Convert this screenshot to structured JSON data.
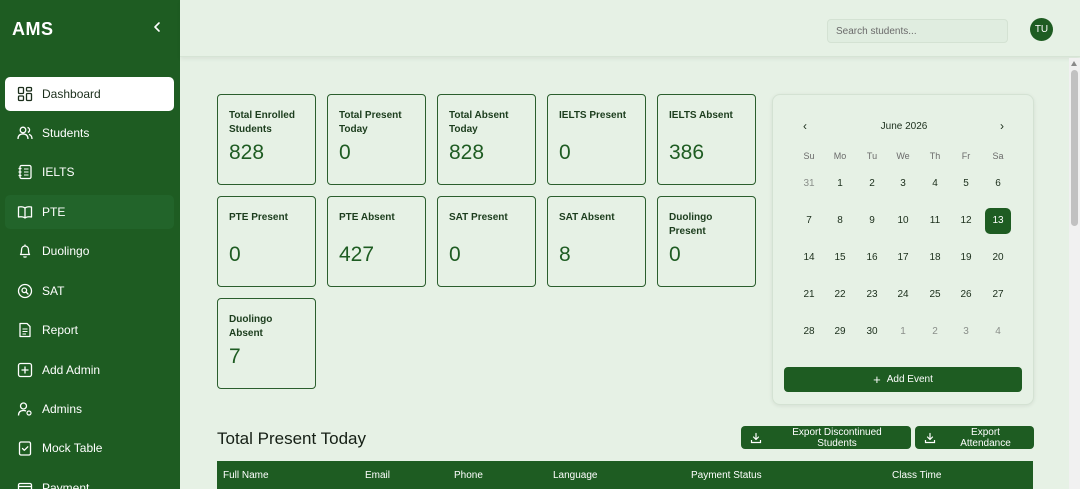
{
  "app": {
    "brand": "AMS"
  },
  "sidebar": {
    "items": [
      {
        "label": "Dashboard",
        "icon": "dashboard-icon"
      },
      {
        "label": "Students",
        "icon": "users-icon"
      },
      {
        "label": "IELTS",
        "icon": "notebook-icon"
      },
      {
        "label": "PTE",
        "icon": "book-open-icon"
      },
      {
        "label": "Duolingo",
        "icon": "bell-icon"
      },
      {
        "label": "SAT",
        "icon": "search-circle-icon"
      },
      {
        "label": "Report",
        "icon": "file-text-icon"
      },
      {
        "label": "Add Admin",
        "icon": "plus-square-icon"
      },
      {
        "label": "Admins",
        "icon": "user-gear-icon"
      },
      {
        "label": "Mock Table",
        "icon": "clipboard-check-icon"
      },
      {
        "label": "Payment",
        "icon": "payment-icon"
      }
    ]
  },
  "header": {
    "search_placeholder": "Search students...",
    "avatar_initials": "TU"
  },
  "stats": [
    {
      "label": "Total Enrolled Students",
      "value": "828"
    },
    {
      "label": "Total Present Today",
      "value": "0"
    },
    {
      "label": "Total Absent Today",
      "value": "828"
    },
    {
      "label": "IELTS Present",
      "value": "0"
    },
    {
      "label": "IELTS Absent",
      "value": "386"
    },
    {
      "label": "PTE Present",
      "value": "0"
    },
    {
      "label": "PTE Absent",
      "value": "427"
    },
    {
      "label": "SAT Present",
      "value": "0"
    },
    {
      "label": "SAT Absent",
      "value": "8"
    },
    {
      "label": "Duolingo Present",
      "value": "0"
    },
    {
      "label": "Duolingo Absent",
      "value": "7"
    }
  ],
  "calendar": {
    "month_label": "June 2026",
    "prev": "‹",
    "next": "›",
    "weekdays": [
      "Su",
      "Mo",
      "Tu",
      "We",
      "Th",
      "Fr",
      "Sa"
    ],
    "weeks": [
      [
        "31",
        "1",
        "2",
        "3",
        "4",
        "5",
        "6"
      ],
      [
        "7",
        "8",
        "9",
        "10",
        "11",
        "12",
        "13"
      ],
      [
        "14",
        "15",
        "16",
        "17",
        "18",
        "19",
        "20"
      ],
      [
        "21",
        "22",
        "23",
        "24",
        "25",
        "26",
        "27"
      ],
      [
        "28",
        "29",
        "30",
        "1",
        "2",
        "3",
        "4"
      ]
    ],
    "selected_day": "13",
    "add_event_label": "Add Event"
  },
  "section": {
    "title": "Total Present Today"
  },
  "actions": {
    "export_discontinued": "Export Discontinued Students",
    "export_attendance": "Export Attendance"
  },
  "table": {
    "columns": [
      "Full Name",
      "Email",
      "Phone",
      "Language",
      "Payment Status",
      "Class Time"
    ]
  },
  "colors": {
    "primary": "#1e5c22",
    "background": "#e6f1e5",
    "card_border": "#2b5e2d"
  }
}
